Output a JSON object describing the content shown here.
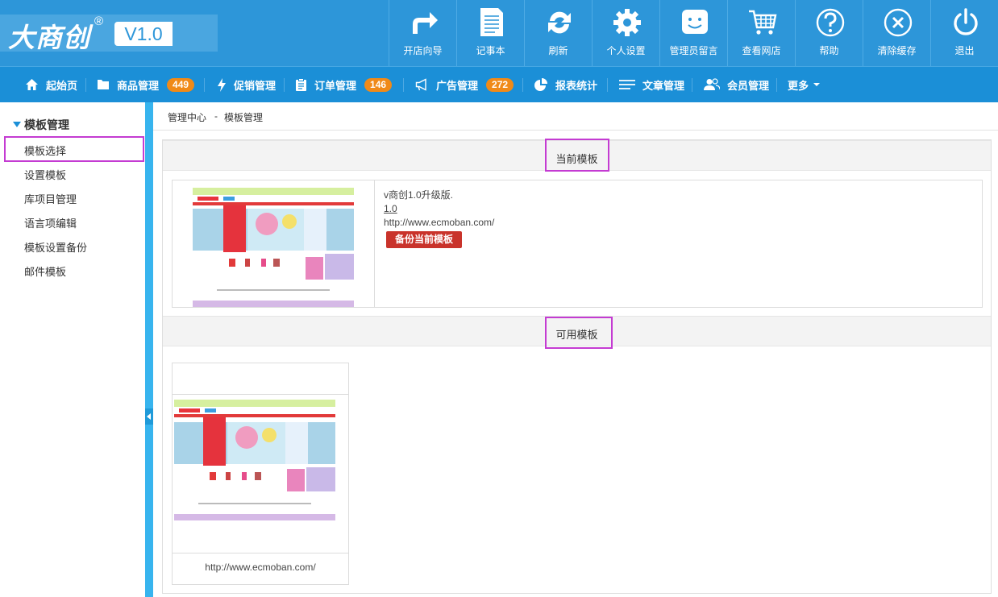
{
  "logo": {
    "brand": "大商创",
    "reg": "®",
    "version": "V1.0"
  },
  "toolbar": [
    {
      "label": "开店向导",
      "icon": "share-arrow-icon"
    },
    {
      "label": "记事本",
      "icon": "notepad-icon"
    },
    {
      "label": "刷新",
      "icon": "refresh-icon"
    },
    {
      "label": "个人设置",
      "icon": "gear-icon"
    },
    {
      "label": "管理员留言",
      "icon": "smile-message-icon"
    },
    {
      "label": "查看网店",
      "icon": "cart-icon"
    },
    {
      "label": "帮助",
      "icon": "question-icon"
    },
    {
      "label": "清除缓存",
      "icon": "close-circle-icon"
    },
    {
      "label": "退出",
      "icon": "power-icon"
    }
  ],
  "nav": [
    {
      "label": "起始页",
      "icon": "home-icon"
    },
    {
      "label": "商品管理",
      "icon": "folder-icon",
      "badge": "449"
    },
    {
      "label": "促销管理",
      "icon": "lightning-icon"
    },
    {
      "label": "订单管理",
      "icon": "clipboard-icon",
      "badge": "146"
    },
    {
      "label": "广告管理",
      "icon": "megaphone-icon",
      "badge": "272"
    },
    {
      "label": "报表统计",
      "icon": "pie-chart-icon"
    },
    {
      "label": "文章管理",
      "icon": "list-icon"
    },
    {
      "label": "会员管理",
      "icon": "users-icon"
    },
    {
      "label": "更多",
      "icon": "caret-down-icon"
    }
  ],
  "sidebar": {
    "title": "模板管理",
    "items": [
      "模板选择",
      "设置模板",
      "库项目管理",
      "语言项编辑",
      "模板设置备份",
      "邮件模板"
    ]
  },
  "breadcrumb": {
    "root": "管理中心",
    "sep": "-",
    "current": "模板管理"
  },
  "current_template": {
    "heading": "当前模板",
    "name": "v商创1.0升级版.",
    "version": "1.0",
    "url": "http://www.ecmoban.com/",
    "backup_label": "备份当前模板"
  },
  "available_templates": {
    "heading": "可用模板",
    "items": [
      {
        "url": "http://www.ecmoban.com/"
      }
    ]
  },
  "colors": {
    "topbar": "#2d96d9",
    "navbar": "#1b8fd7",
    "badge": "#f08a18",
    "backup_button": "#c9332b",
    "highlight": "#c43bd2"
  }
}
